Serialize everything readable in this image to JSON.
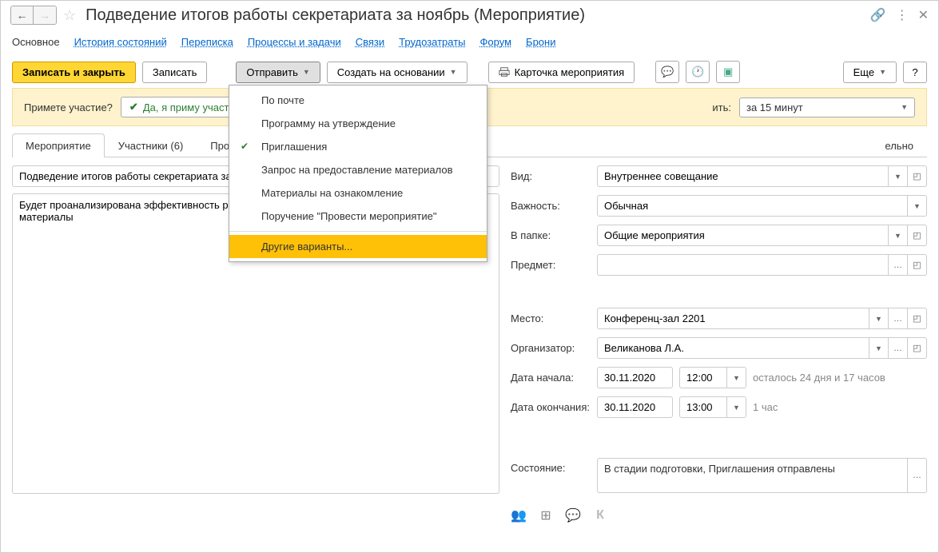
{
  "title": "Подведение итогов работы секретариата за ноябрь (Мероприятие)",
  "nav_tabs": {
    "main": "Основное",
    "history": "История состояний",
    "correspondence": "Переписка",
    "processes": "Процессы и задачи",
    "links": "Связи",
    "labor": "Трудозатраты",
    "forum": "Форум",
    "bookings": "Брони"
  },
  "toolbar": {
    "save_close": "Записать и закрыть",
    "save": "Записать",
    "send": "Отправить",
    "create_based": "Создать на основании",
    "card": "Карточка мероприятия",
    "more": "Еще"
  },
  "send_menu": {
    "by_mail": "По почте",
    "program_approval": "Программу на утверждение",
    "invitations": "Приглашения",
    "materials_request": "Запрос на предоставление материалов",
    "materials_review": "Материалы на ознакомление",
    "task_conduct": "Поручение \"Провести мероприятие\"",
    "other": "Другие варианты..."
  },
  "notice": {
    "question": "Примете участие?",
    "yes": "Да, я приму участи",
    "remind_label": "ить:",
    "remind_value": "за 15 минут"
  },
  "sub_tabs": {
    "event": "Мероприятие",
    "participants": "Участники (6)",
    "program": "Программ",
    "additional": "ельно"
  },
  "form": {
    "subject_value": "Подведение итогов работы секретариата за",
    "description": "Будет проанализирована эффективность р\nматериалы",
    "type_label": "Вид:",
    "type_value": "Внутреннее совещание",
    "importance_label": "Важность:",
    "importance_value": "Обычная",
    "folder_label": "В папке:",
    "folder_value": "Общие мероприятия",
    "subject_label": "Предмет:",
    "subject_field_value": "",
    "place_label": "Место:",
    "place_value": "Конференц-зал 2201",
    "organizer_label": "Организатор:",
    "organizer_value": "Великанова Л.А.",
    "start_label": "Дата начала:",
    "start_date": "30.11.2020",
    "start_time": "12:00",
    "time_left": "осталось 24 дня и 17 часов",
    "end_label": "Дата окончания:",
    "end_date": "30.11.2020",
    "end_time": "13:00",
    "duration": "1 час",
    "status_label": "Состояние:",
    "status_value": "В стадии подготовки, Приглашения отправлены"
  }
}
